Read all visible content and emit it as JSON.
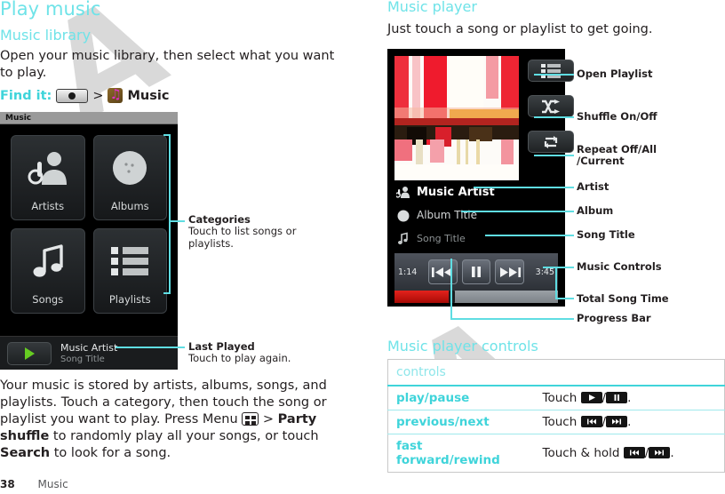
{
  "page": {
    "title": "Play music",
    "footer_page_number": "38",
    "footer_section": "Music"
  },
  "left": {
    "section_heading": "Music library",
    "intro": "Open your music library, then select what you want to play.",
    "find_it_label": "Find it:",
    "find_it_separator": ">",
    "find_it_app": "Music",
    "screenshot": {
      "status_title": "Music",
      "tiles": [
        {
          "label": "Artists",
          "icon": "artist-icon"
        },
        {
          "label": "Albums",
          "icon": "album-disc-icon"
        },
        {
          "label": "Songs",
          "icon": "music-note-icon"
        },
        {
          "label": "Playlists",
          "icon": "playlist-icon"
        }
      ],
      "last_played": {
        "play_icon": "play-icon",
        "artist": "Music Artist",
        "song": "Song Title"
      }
    },
    "callouts": [
      {
        "title": "Categories",
        "desc": "Touch to list songs or playlists."
      },
      {
        "title": "Last Played",
        "desc": "Touch to play again."
      }
    ],
    "body_paragraph": {
      "part1": "Your music is stored by artists, albums, songs, and playlists. Touch a category, then touch the song or playlist you want to play. Press Menu ",
      "menu_icon": "menu-key-icon",
      "part2": " > ",
      "bold1": "Party shuffle",
      "part3": " to randomly play all your songs, or touch ",
      "bold2": "Search",
      "part4": " to look for a song."
    }
  },
  "right": {
    "section_heading": "Music player",
    "intro": "Just touch a song or playlist to get going.",
    "screenshot": {
      "album_art": "album-art-abstract-red",
      "buttons": [
        {
          "name": "open-playlist-button",
          "icon": "playlist-icon"
        },
        {
          "name": "shuffle-button",
          "icon": "shuffle-icon"
        },
        {
          "name": "repeat-button",
          "icon": "repeat-icon"
        }
      ],
      "artist": "Music Artist",
      "album": "Album Title",
      "song": "Song Title",
      "elapsed_time": "1:14",
      "total_time": "3:45",
      "progress_percent": 35,
      "controls": [
        {
          "name": "previous-button",
          "icon": "previous-icon"
        },
        {
          "name": "pause-button",
          "icon": "pause-icon"
        },
        {
          "name": "next-button",
          "icon": "next-icon"
        }
      ]
    },
    "callouts": [
      "Open Playlist",
      "Shuffle On/Off",
      "Repeat Off/All\n/Current",
      "Artist",
      "Album",
      "Song Title",
      "Music Controls",
      "Total Song Time",
      "Progress Bar"
    ],
    "table_heading": "Music player controls",
    "table": {
      "header": "controls",
      "rows": [
        {
          "name": "play/pause",
          "action_pre": "Touch",
          "icons": [
            "play-icon",
            "pause-icon"
          ],
          "action_post": "."
        },
        {
          "name": "previous/next",
          "action_pre": "Touch",
          "icons": [
            "previous-icon",
            "next-icon"
          ],
          "action_post": "."
        },
        {
          "name": "fast forward/rewind",
          "action_pre": "Touch & hold",
          "icons": [
            "previous-icon",
            "next-icon"
          ],
          "action_post": "."
        }
      ]
    }
  },
  "colors": {
    "accent": "#6fe3e8",
    "accent_strong": "#3fd4da",
    "text": "#231f20",
    "progress": "#d6241c"
  }
}
